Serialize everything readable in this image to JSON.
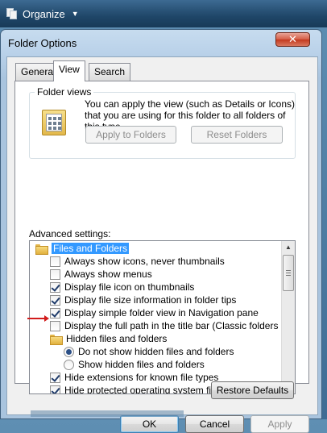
{
  "explorer": {
    "organize_label": "Organize",
    "organize_caret": "▼"
  },
  "dialog": {
    "title": "Folder Options",
    "close_glyph": "✕",
    "tabs": [
      {
        "label": "General"
      },
      {
        "label": "View"
      },
      {
        "label": "Search"
      }
    ],
    "active_tab": "View",
    "folder_views": {
      "label": "Folder views",
      "description": "You can apply the view (such as Details or Icons) that you are using for this folder to all folders of this type.",
      "apply_button": "Apply to Folders",
      "reset_button": "Reset Folders"
    },
    "advanced_label": "Advanced settings:",
    "tree": [
      {
        "type": "folder",
        "label": "Files and Folders",
        "selected": true
      },
      {
        "type": "checkbox",
        "label": "Always show icons, never thumbnails",
        "checked": false
      },
      {
        "type": "checkbox",
        "label": "Always show menus",
        "checked": false
      },
      {
        "type": "checkbox",
        "label": "Display file icon on thumbnails",
        "checked": true
      },
      {
        "type": "checkbox",
        "label": "Display file size information in folder tips",
        "checked": true
      },
      {
        "type": "checkbox",
        "label": "Display simple folder view in Navigation pane",
        "checked": true
      },
      {
        "type": "checkbox",
        "label": "Display the full path in the title bar (Classic folders only)",
        "checked": false
      },
      {
        "type": "folder",
        "label": "Hidden files and folders"
      },
      {
        "type": "radio",
        "label": "Do not show hidden files and folders",
        "checked": true
      },
      {
        "type": "radio",
        "label": "Show hidden files and folders",
        "checked": false
      },
      {
        "type": "checkbox",
        "label": "Hide extensions for known file types",
        "checked": true
      },
      {
        "type": "checkbox",
        "label": "Hide protected operating system files (Recommended)",
        "checked": true
      }
    ],
    "restore_button": "Restore Defaults",
    "ok_button": "OK",
    "cancel_button": "Cancel",
    "apply_button": "Apply",
    "apply_enabled": false
  },
  "colors": {
    "selection": "#3399ff",
    "annotation_arrow": "#d21c1c",
    "close_button": "#c3381d"
  }
}
